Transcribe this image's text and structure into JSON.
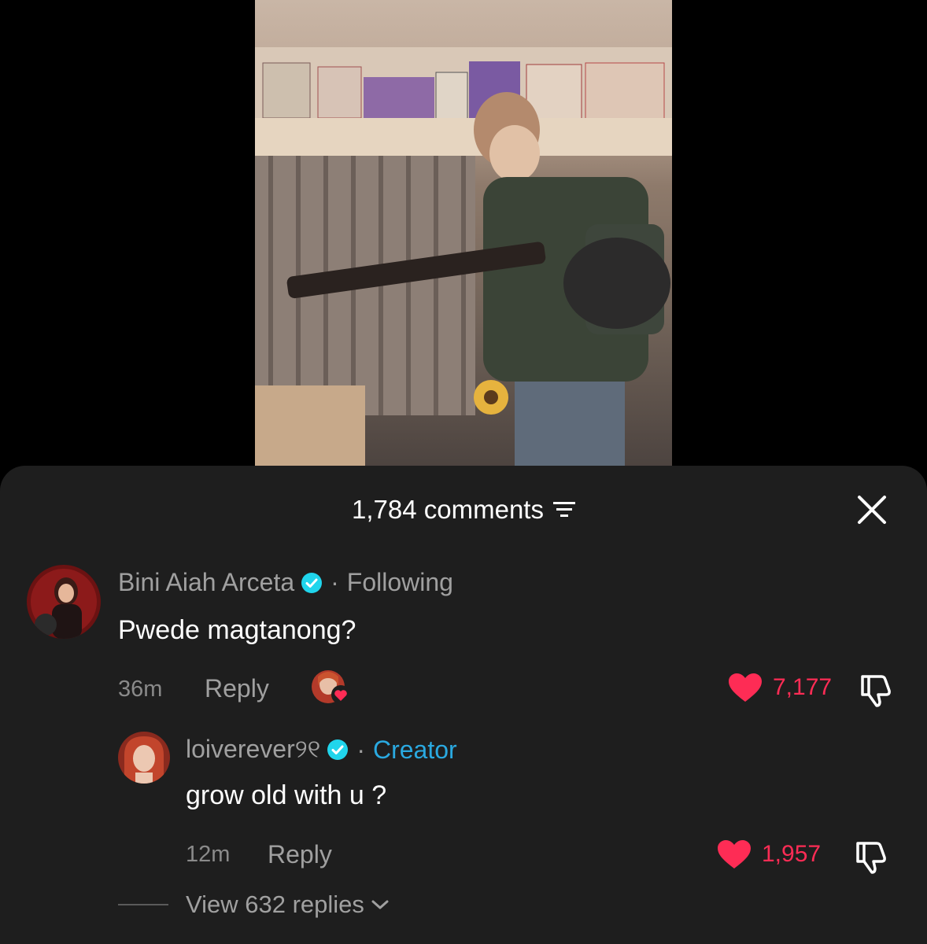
{
  "comments_header": {
    "count_label": "1,784 comments"
  },
  "comments": [
    {
      "author": "Bini Aiah Arceta",
      "verified": true,
      "tag": "Following",
      "text": "Pwede magtanong?",
      "time": "36m",
      "reply_label": "Reply",
      "likes": "7,177"
    },
    {
      "author": "loiverever୨୧",
      "verified": true,
      "tag": "Creator",
      "text": "grow old with u ?",
      "time": "12m",
      "reply_label": "Reply",
      "likes": "1,957"
    }
  ],
  "view_replies_label": "View 632 replies",
  "colors": {
    "accent_like": "#fe2c55",
    "creator_tag": "#2aa9e0",
    "verified_badge": "#20d5ec",
    "sheet_bg": "#1e1e1e"
  },
  "icons": [
    "filter-icon",
    "close-icon",
    "verified-icon",
    "heart-icon",
    "dislike-icon",
    "chevron-down-icon"
  ]
}
